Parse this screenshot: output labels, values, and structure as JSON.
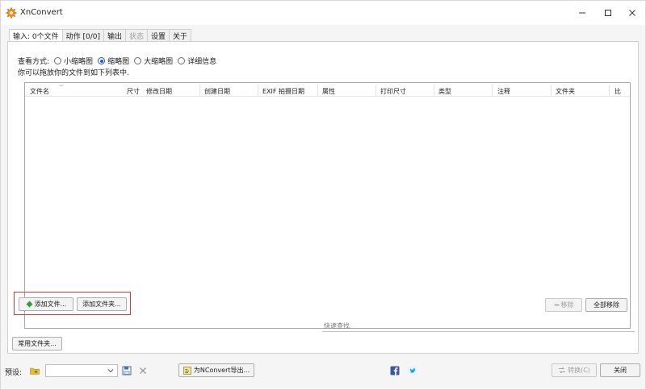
{
  "window": {
    "title": "XnConvert",
    "controls": {
      "minimize_icon": "minimize-icon",
      "maximize_icon": "maximize-icon",
      "close_icon": "close-icon"
    }
  },
  "tabs": [
    {
      "label": "输入: 0个文件",
      "state": "active"
    },
    {
      "label": "动作 [0/0]",
      "state": "normal"
    },
    {
      "label": "输出",
      "state": "normal"
    },
    {
      "label": "状态",
      "state": "disabled"
    },
    {
      "label": "设置",
      "state": "normal"
    },
    {
      "label": "关于",
      "state": "normal"
    }
  ],
  "input": {
    "view_mode_label": "查看方式:",
    "view_modes": [
      {
        "label": "小缩略图",
        "checked": false
      },
      {
        "label": "缩略图",
        "checked": true
      },
      {
        "label": "大缩略图",
        "checked": false
      },
      {
        "label": "详细信息",
        "checked": false
      }
    ],
    "drag_hint": "你可以拖放你的文件到如下列表中.",
    "columns": [
      "文件名",
      "尺寸",
      "修改日期",
      "创建日期",
      "EXIF 拍摄日期",
      "属性",
      "打印尺寸",
      "类型",
      "注释",
      "文件夹",
      "比"
    ],
    "add_files_label": "添加文件...",
    "add_folder_label": "添加文件夹...",
    "remove_label": "移除",
    "remove_all_label": "全部移除",
    "quick_search_placeholder": "快速查找",
    "favorites_label": "常用文件夹..."
  },
  "bottom": {
    "preset_label": "预设:",
    "preset_value": "",
    "export_label": "为NConvert导出...",
    "convert_label": "转换(C)",
    "close_label": "关闭"
  },
  "colors": {
    "highlight": "#d9373b",
    "radio_checked": "#1a5fb4",
    "add_icon": "#3a9a3a",
    "facebook": "#3b5998",
    "twitter": "#1da1f2"
  }
}
